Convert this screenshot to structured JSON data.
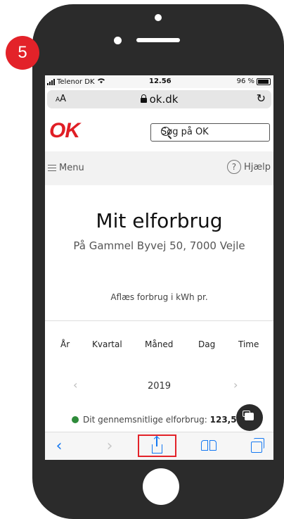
{
  "step_badge": "5",
  "status_bar": {
    "carrier": "Telenor DK",
    "time": "12.56",
    "battery": "96 %"
  },
  "url_bar": {
    "text_size_label": "AA",
    "url": "ok.dk"
  },
  "site_header": {
    "logo": "OK",
    "search_placeholder": "Søg på OK"
  },
  "menu_bar": {
    "menu_label": "Menu",
    "help_label": "Hjælp",
    "help_icon": "?"
  },
  "page": {
    "title": "Mit elforbrug",
    "address": "På Gammel Byvej 50, 7000 Vejle",
    "read_label": "Aflæs forbrug i kWh pr.",
    "period_tabs": [
      "År",
      "Kvartal",
      "Måned",
      "Dag",
      "Time"
    ],
    "year": "2019",
    "prev_arrow": "‹",
    "next_arrow": "›",
    "avg_label": "Dit gennemsnitlige elforbrug:",
    "avg_value": "123,51 k"
  },
  "toolbar": {
    "back": "‹",
    "forward": "›"
  },
  "colors": {
    "accent": "#e32229",
    "ios_blue": "#1478f2",
    "dot_green": "#2e8b3a"
  }
}
